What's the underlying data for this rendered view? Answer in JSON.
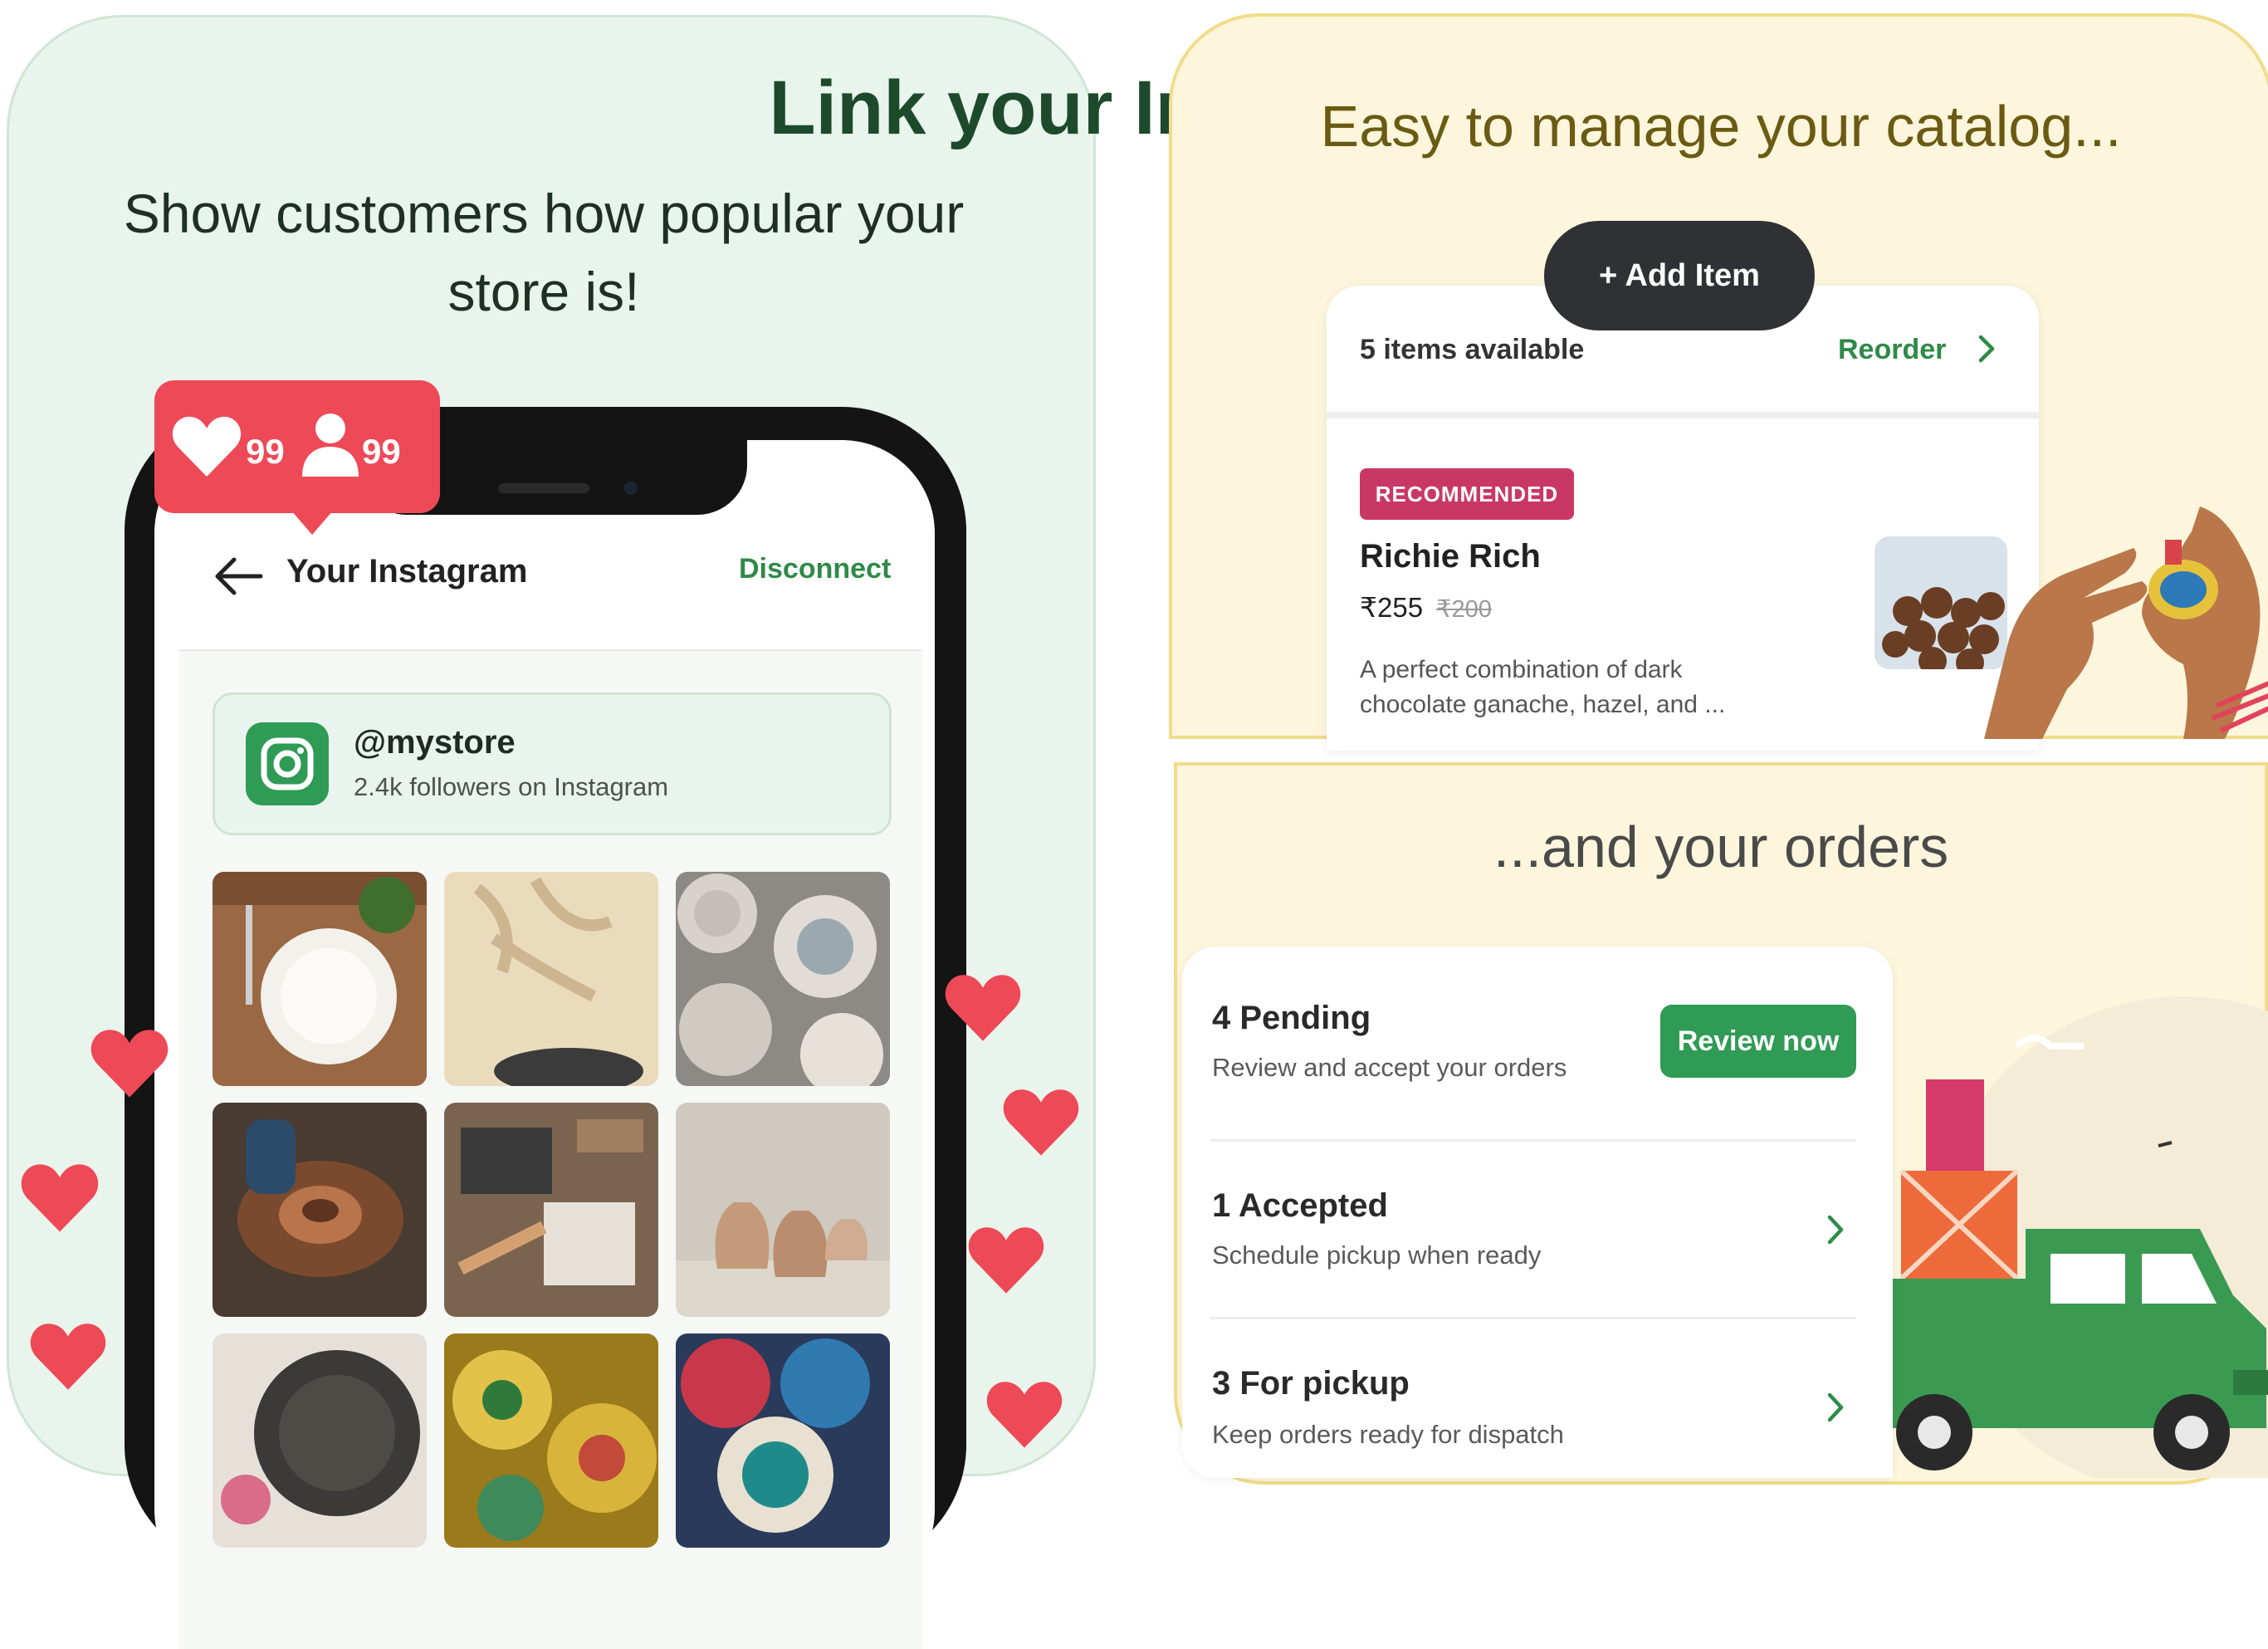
{
  "instagram_panel": {
    "title": "Link your Instagram",
    "subtitle": "Show customers how popular your store is!",
    "notification": {
      "likes": "99",
      "followers": "99"
    },
    "header": {
      "title": "Your Instagram",
      "disconnect_label": "Disconnect"
    },
    "profile": {
      "handle": "@mystore",
      "followers": "2.4k followers on Instagram"
    },
    "grid_posts": [
      "dinner-plate-table",
      "shadow-bowl",
      "stacked-plates",
      "pottery-wheel",
      "workshop-tools",
      "clay-vases",
      "embossed-plate",
      "painted-plates",
      "colorful-bowls"
    ]
  },
  "catalog_panel": {
    "title": "Easy to manage your catalog...",
    "add_item_label": "+ Add Item",
    "items_count": "5 items available",
    "reorder_label": "Reorder",
    "product": {
      "badge": "RECOMMENDED",
      "name": "Richie Rich",
      "price": "₹255",
      "old_price": "₹200",
      "description": "A perfect combination of dark chocolate ganache, hazel, and ..."
    }
  },
  "orders_panel": {
    "title": "...and your orders",
    "orders": [
      {
        "title": "4 Pending",
        "subtitle": "Review and accept your orders",
        "action": "Review now"
      },
      {
        "title": "1 Accepted",
        "subtitle": "Schedule pickup when ready"
      },
      {
        "title": "3 For pickup",
        "subtitle": "Keep orders ready for dispatch"
      }
    ]
  },
  "colors": {
    "brand_green": "#2f9b55",
    "heart_red": "#ee4957",
    "badge_pink": "#c93864",
    "panel_green": "#e8f4ec",
    "panel_yellow": "#fdf6dd"
  }
}
